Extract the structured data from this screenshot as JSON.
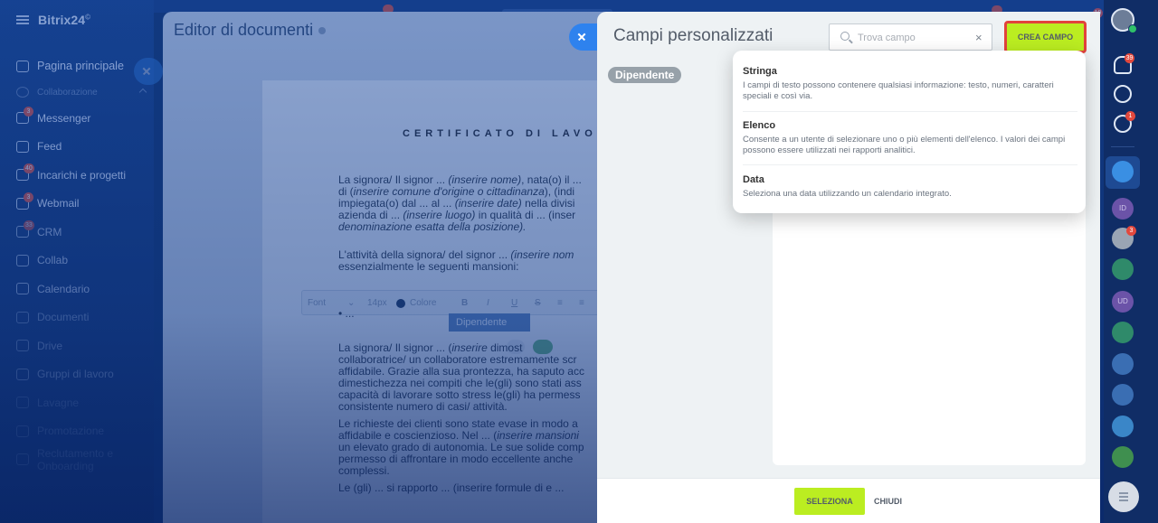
{
  "app": {
    "name": "Bitrix24",
    "trademark": "©"
  },
  "sidebar": {
    "items": [
      {
        "label": "Pagina principale",
        "icon": "home-icon"
      },
      {
        "label": "Collaborazione",
        "icon": "collaboration-icon",
        "section": true
      },
      {
        "label": "Messenger",
        "icon": "chat-icon",
        "count": "3"
      },
      {
        "label": "Feed",
        "icon": "feed-icon"
      },
      {
        "label": "Incarichi e progetti",
        "icon": "tasks-icon",
        "count": "40"
      },
      {
        "label": "Webmail",
        "icon": "mail-icon",
        "count": "3"
      },
      {
        "label": "CRM",
        "icon": "crm-icon",
        "count": "33"
      },
      {
        "label": "Collab",
        "icon": "collab-icon"
      },
      {
        "label": "Calendario",
        "icon": "calendar-icon"
      },
      {
        "label": "Documenti",
        "icon": "documents-icon"
      },
      {
        "label": "Drive",
        "icon": "drive-icon"
      },
      {
        "label": "Gruppi di lavoro",
        "icon": "groups-icon"
      },
      {
        "label": "Lavagne",
        "icon": "boards-icon"
      },
      {
        "label": "Promotazione",
        "icon": "promotion-icon"
      },
      {
        "label": "Reclutamento e Onboarding",
        "icon": "recruitment-icon"
      }
    ]
  },
  "editor": {
    "title": "Editor di documenti",
    "doc_title": "CERTIFICATO DI LAVO",
    "paragraph1": [
      [
        "La signora/ Il signor ... ",
        "(inserire nome)",
        ", nata(o) il ..."
      ],
      [
        "di (",
        "inserire comune d'origine o cittadinanza",
        "), (indi"
      ],
      [
        "impiegata(o) dal ... al ... ",
        "(inserire date)",
        " nella divisi"
      ],
      [
        "azienda di ... ",
        "(inserire luogo)",
        " in qualità di ... (inser"
      ],
      [
        "",
        "denominazione esatta della posizione).",
        ""
      ]
    ],
    "paragraph2": [
      [
        "L'attività della signora/ del signor ... ",
        "(inserire nom",
        ""
      ],
      [
        "essenzialmente le seguenti mansioni:",
        "",
        ""
      ]
    ],
    "toolbar": {
      "font": "Font",
      "size": "14px",
      "color": "Colore",
      "bold": "B",
      "italic": "I",
      "underline": "U",
      "strike": "S"
    },
    "bullet": "• ...",
    "field_chip": "Dipendente",
    "paragraph3": [
      [
        "La signora/ Il signor ... (",
        "inserire",
        "      dimost"
      ],
      [
        "collaboratrice/ un collaboratore estremamente scr",
        "",
        ""
      ],
      [
        "affidabile. Grazie alla sua prontezza, ha saputo acc",
        "",
        ""
      ],
      [
        "dimestichezza nei compiti che le(gli) sono stati ass",
        "",
        ""
      ],
      [
        "capacità di lavorare sotto stress le(gli) ha permess",
        "",
        ""
      ],
      [
        "consistente numero di casi/ attività.",
        "",
        ""
      ]
    ],
    "paragraph4": [
      [
        "Le richieste dei clienti sono state evase in modo a",
        "",
        ""
      ],
      [
        "affidabile e coscienzioso. Nel ... (",
        "inserire mansioni",
        ""
      ],
      [
        "un elevato grado di autonomia. Le sue solide comp",
        "",
        ""
      ],
      [
        "permesso di affrontare in modo eccellente anche",
        "",
        ""
      ],
      [
        "complessi.",
        "",
        ""
      ]
    ],
    "paragraph5": [
      [
        "Le (gli) ... si rapporto ... (inserire formule di e ... ",
        "",
        ""
      ]
    ]
  },
  "panel": {
    "title": "Campi personalizzati",
    "search_placeholder": "Trova campo",
    "clear": "×",
    "create_button": "CREA CAMPO",
    "tag": "Dipendente",
    "dropdown": [
      {
        "title": "Stringa",
        "description": "I campi di testo possono contenere qualsiasi informazione: testo, numeri, caratteri speciali e così via."
      },
      {
        "title": "Elenco",
        "description": "Consente a un utente di selezionare uno o più elementi dell'elenco. I valori dei campi possono essere utilizzati nei rapporti analitici."
      },
      {
        "title": "Data",
        "description": "Seleziona una data utilizzando un calendario integrato."
      }
    ],
    "footer": {
      "select": "SELEZIONA",
      "close": "CHIUDI"
    }
  },
  "rail": {
    "badges": {
      "notifications": "39",
      "chat": "1",
      "avatar": "3",
      "top": "19"
    },
    "initials": [
      "ID",
      "UD"
    ]
  },
  "colors": {
    "accent_green": "#bbed21",
    "highlight_red": "#e2433c",
    "sidebar_blue": "#153f86",
    "badge_red": "#e2483d"
  }
}
